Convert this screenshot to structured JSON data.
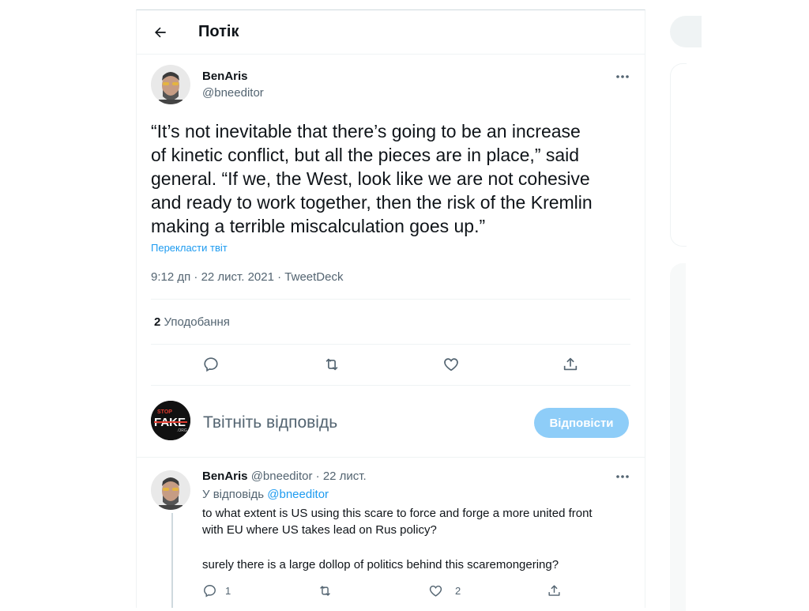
{
  "header": {
    "title": "Потік"
  },
  "tweet": {
    "author_name": "BenAris",
    "author_handle": "@bneeditor",
    "text_lines": [
      "“It’s not inevitable that there’s going to be an increase",
      "of kinetic conflict, but all the pieces are in place,” said",
      "general. “If we, the West, look like we are not cohesive",
      "and ready to work together, then the risk of the Kremlin",
      "making a terrible miscalculation goes up.”"
    ],
    "translate": "Перекласти твіт",
    "timestamp": "9:12 дп · 22 лист. 2021 · TweetDeck",
    "likes_count": "2",
    "likes_label": "Уподобання"
  },
  "compose": {
    "logo_text_top": "STOP",
    "logo_text_main": "FAKE",
    "logo_text_bottom": ".ORG",
    "placeholder": "Твітніть відповідь",
    "button": "Відповісти"
  },
  "reply": {
    "author_name": "BenAris",
    "author_handle": "@bneeditor",
    "separator": "·",
    "date": "22 лист.",
    "replying_prefix": "У відповідь",
    "replying_to": "@bneeditor",
    "text_line_1": "to what extent is US using this scare to force and forge a more united front",
    "text_line_2": "with EU where US takes lead on Rus policy?",
    "text_line_3": "surely there is a large dollop of politics behind this scaremongering?",
    "reply_count": "1",
    "like_count": "2"
  },
  "icons": {
    "back": "arrow-left-icon",
    "more": "more-icon",
    "reply": "reply-icon",
    "retweet": "retweet-icon",
    "like": "heart-icon",
    "share": "share-icon"
  },
  "colors": {
    "accent": "#1d9bf0",
    "button_disabled": "#8ecdf8",
    "secondary_text": "#536471"
  }
}
